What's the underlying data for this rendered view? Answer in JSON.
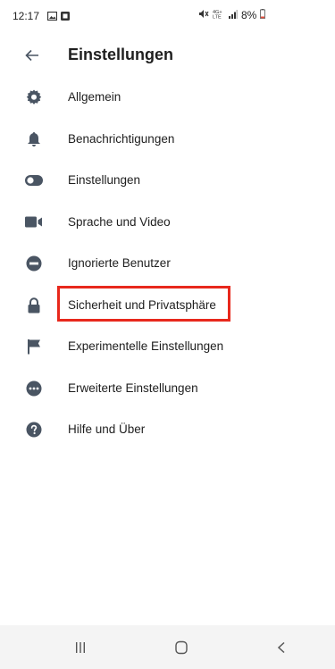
{
  "status_bar": {
    "time": "12:17",
    "battery": "8%",
    "icons": [
      "gallery-icon",
      "notification-icon",
      "mute-icon",
      "4g-lte-icon",
      "signal-icon",
      "battery-icon"
    ]
  },
  "app_bar": {
    "title": "Einstellungen",
    "back_icon": "arrow-back-icon"
  },
  "menu": {
    "items": [
      {
        "label": "Allgemein",
        "icon": "gear-icon"
      },
      {
        "label": "Benachrichtigungen",
        "icon": "bell-icon"
      },
      {
        "label": "Einstellungen",
        "icon": "toggle-icon"
      },
      {
        "label": "Sprache und Video",
        "icon": "video-camera-icon"
      },
      {
        "label": "Ignorierte Benutzer",
        "icon": "block-icon"
      },
      {
        "label": "Sicherheit und Privatsphäre",
        "icon": "lock-icon",
        "highlighted": true
      },
      {
        "label": "Experimentelle Einstellungen",
        "icon": "flag-icon"
      },
      {
        "label": "Erweiterte Einstellungen",
        "icon": "more-horizontal-icon"
      },
      {
        "label": "Hilfe und Über",
        "icon": "help-icon"
      }
    ]
  },
  "highlight_color": "#e8281c",
  "icon_color": "#4a5563",
  "nav_bar": {
    "buttons": [
      "recents-icon",
      "home-icon",
      "back-icon"
    ]
  }
}
